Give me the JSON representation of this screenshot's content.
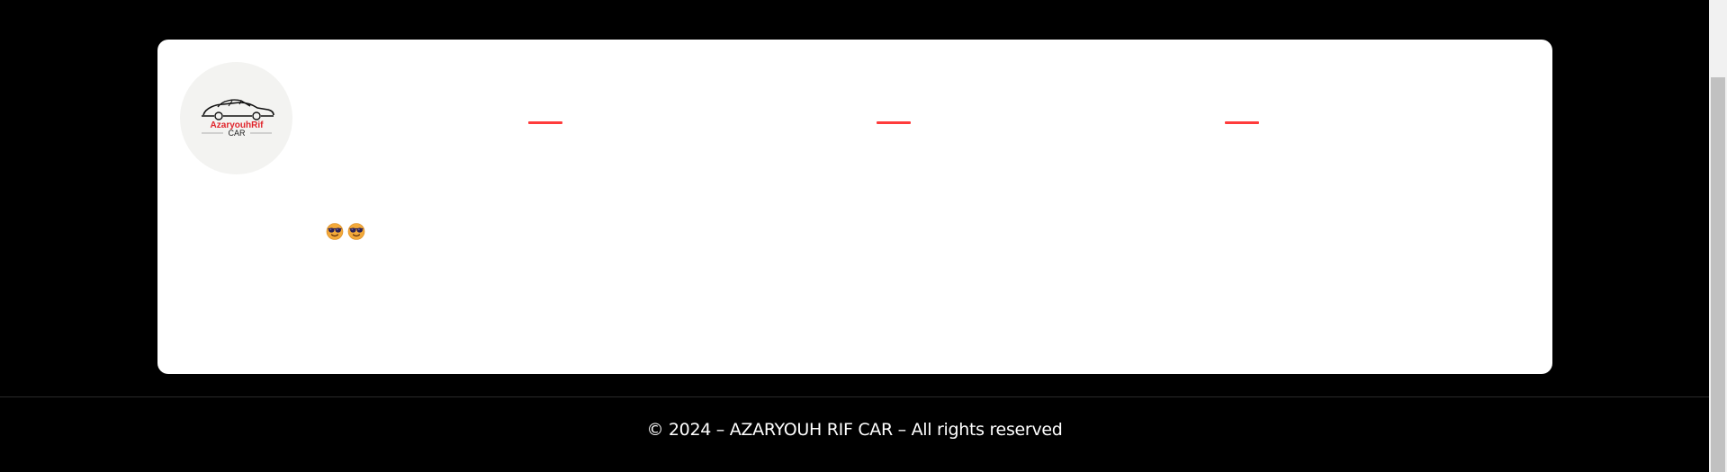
{
  "brand": {
    "logo_text_top": "AzaryouhRif",
    "logo_text_bottom": "CAR",
    "accent_color": "#ff3b3b"
  },
  "content": {
    "emojis": [
      "smiling-face-with-sunglasses",
      "smiling-face-with-sunglasses"
    ]
  },
  "footer": {
    "copyright": "© 2024 – AZARYOUH RIF CAR – All rights reserved"
  }
}
